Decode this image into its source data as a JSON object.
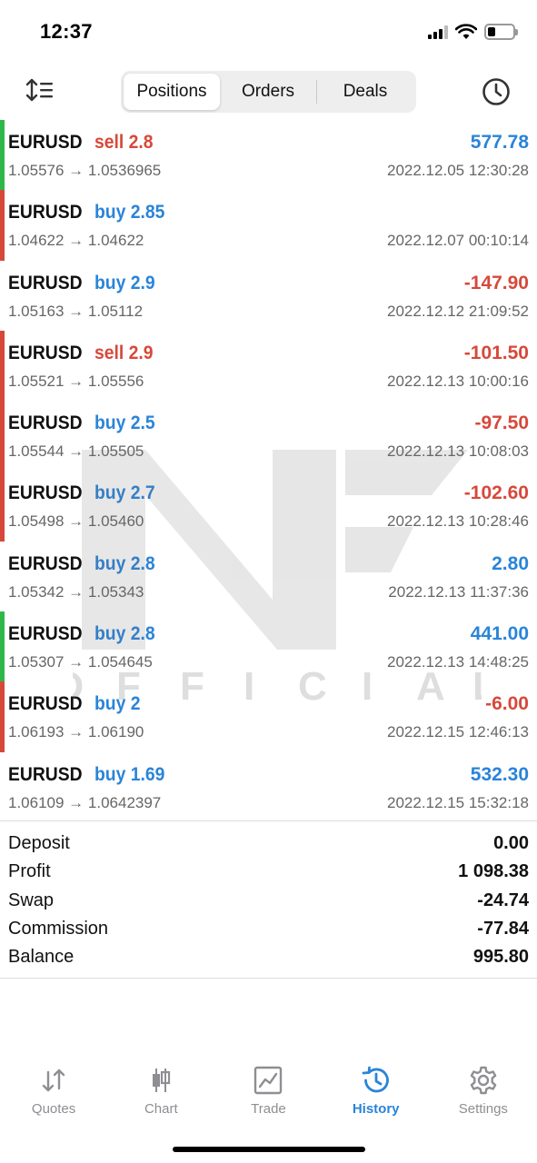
{
  "status_bar": {
    "time": "12:37"
  },
  "toolbar": {
    "segments": [
      {
        "label": "Positions",
        "active": true
      },
      {
        "label": "Orders",
        "active": false
      },
      {
        "label": "Deals",
        "active": false
      }
    ],
    "sort_icon": "sort-icon",
    "history_icon": "clock-icon"
  },
  "colors": {
    "accent": "#2a84d8",
    "loss": "#d7483a",
    "gain_edge": "#2fb84a",
    "loss_edge": "#d7483a"
  },
  "deals": [
    {
      "symbol": "EURUSD",
      "side": "sell",
      "volume": "sell 2.8",
      "prices": "1.05576 → 1.0536965",
      "profit": "577.78",
      "time": "2022.12.05 12:30:28",
      "edge": "gain"
    },
    {
      "symbol": "EURUSD",
      "side": "buy",
      "volume": "buy 2.85",
      "prices": "1.04622 → 1.04622",
      "profit": "",
      "time": "2022.12.07 00:10:14",
      "edge": "loss"
    },
    {
      "symbol": "EURUSD",
      "side": "buy",
      "volume": "buy 2.9",
      "prices": "1.05163 → 1.05112",
      "profit": "-147.90",
      "time": "2022.12.12 21:09:52",
      "edge": "none"
    },
    {
      "symbol": "EURUSD",
      "side": "sell",
      "volume": "sell 2.9",
      "prices": "1.05521 → 1.05556",
      "profit": "-101.50",
      "time": "2022.12.13 10:00:16",
      "edge": "loss"
    },
    {
      "symbol": "EURUSD",
      "side": "buy",
      "volume": "buy 2.5",
      "prices": "1.05544 → 1.05505",
      "profit": "-97.50",
      "time": "2022.12.13 10:08:03",
      "edge": "loss"
    },
    {
      "symbol": "EURUSD",
      "side": "buy",
      "volume": "buy 2.7",
      "prices": "1.05498 → 1.05460",
      "profit": "-102.60",
      "time": "2022.12.13 10:28:46",
      "edge": "loss"
    },
    {
      "symbol": "EURUSD",
      "side": "buy",
      "volume": "buy 2.8",
      "prices": "1.05342 → 1.05343",
      "profit": "2.80",
      "time": "2022.12.13 11:37:36",
      "edge": "none"
    },
    {
      "symbol": "EURUSD",
      "side": "buy",
      "volume": "buy 2.8",
      "prices": "1.05307 → 1.054645",
      "profit": "441.00",
      "time": "2022.12.13 14:48:25",
      "edge": "gain"
    },
    {
      "symbol": "EURUSD",
      "side": "buy",
      "volume": "buy 2",
      "prices": "1.06193 → 1.06190",
      "profit": "-6.00",
      "time": "2022.12.15 12:46:13",
      "edge": "loss"
    },
    {
      "symbol": "EURUSD",
      "side": "buy",
      "volume": "buy 1.69",
      "prices": "1.06109 → 1.0642397",
      "profit": "532.30",
      "time": "2022.12.15 15:32:18",
      "edge": "none"
    }
  ],
  "summary": [
    {
      "label": "Deposit",
      "value": "0.00"
    },
    {
      "label": "Profit",
      "value": "1 098.38"
    },
    {
      "label": "Swap",
      "value": "-24.74"
    },
    {
      "label": "Commission",
      "value": "-77.84"
    },
    {
      "label": "Balance",
      "value": "995.80"
    }
  ],
  "watermark": {
    "text": "OFFICIAL"
  },
  "tabbar": [
    {
      "label": "Quotes",
      "icon": "arrows-updown-icon",
      "active": false
    },
    {
      "label": "Chart",
      "icon": "candlestick-icon",
      "active": false
    },
    {
      "label": "Trade",
      "icon": "trade-chart-icon",
      "active": false
    },
    {
      "label": "History",
      "icon": "history-icon",
      "active": true
    },
    {
      "label": "Settings",
      "icon": "gear-icon",
      "active": false
    }
  ]
}
